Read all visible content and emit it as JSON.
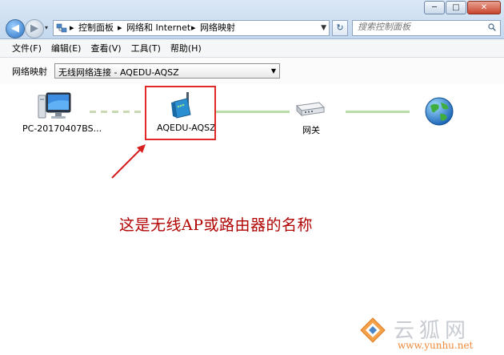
{
  "window": {
    "minimize_glyph": "─",
    "maximize_glyph": "□",
    "close_glyph": "✕"
  },
  "navigation": {
    "back_glyph": "◀",
    "forward_glyph": "▶",
    "history_glyph": "▾"
  },
  "address_bar": {
    "separator": "▸",
    "breadcrumbs": [
      "控制面板",
      "网络和 Internet",
      "网络映射"
    ],
    "refresh_glyph": "↻"
  },
  "search": {
    "placeholder": "搜索控制面板"
  },
  "menu": {
    "items": [
      "文件(F)",
      "编辑(E)",
      "查看(V)",
      "工具(T)",
      "帮助(H)"
    ]
  },
  "toolbar": {
    "label": "网络映射",
    "connection_value": "无线网络连接 - AQEDU-AQSZ",
    "dropdown_glyph": "▼"
  },
  "network_map": {
    "computer_label": "PC-20170407BS...",
    "router_label": "AQEDU-AQSZ",
    "gateway_label": "网关",
    "icons": [
      "computer-icon",
      "wireless-router-icon",
      "gateway-icon",
      "internet-globe-icon"
    ],
    "wireless_link_color": "#c9d9b2",
    "wired_link_color": "#b7dca8"
  },
  "annotation": {
    "text": "这是无线AP或路由器的名称",
    "color": "#b00000"
  },
  "watermark": {
    "chinese": "云狐网",
    "url": "www.yunhu.net"
  }
}
